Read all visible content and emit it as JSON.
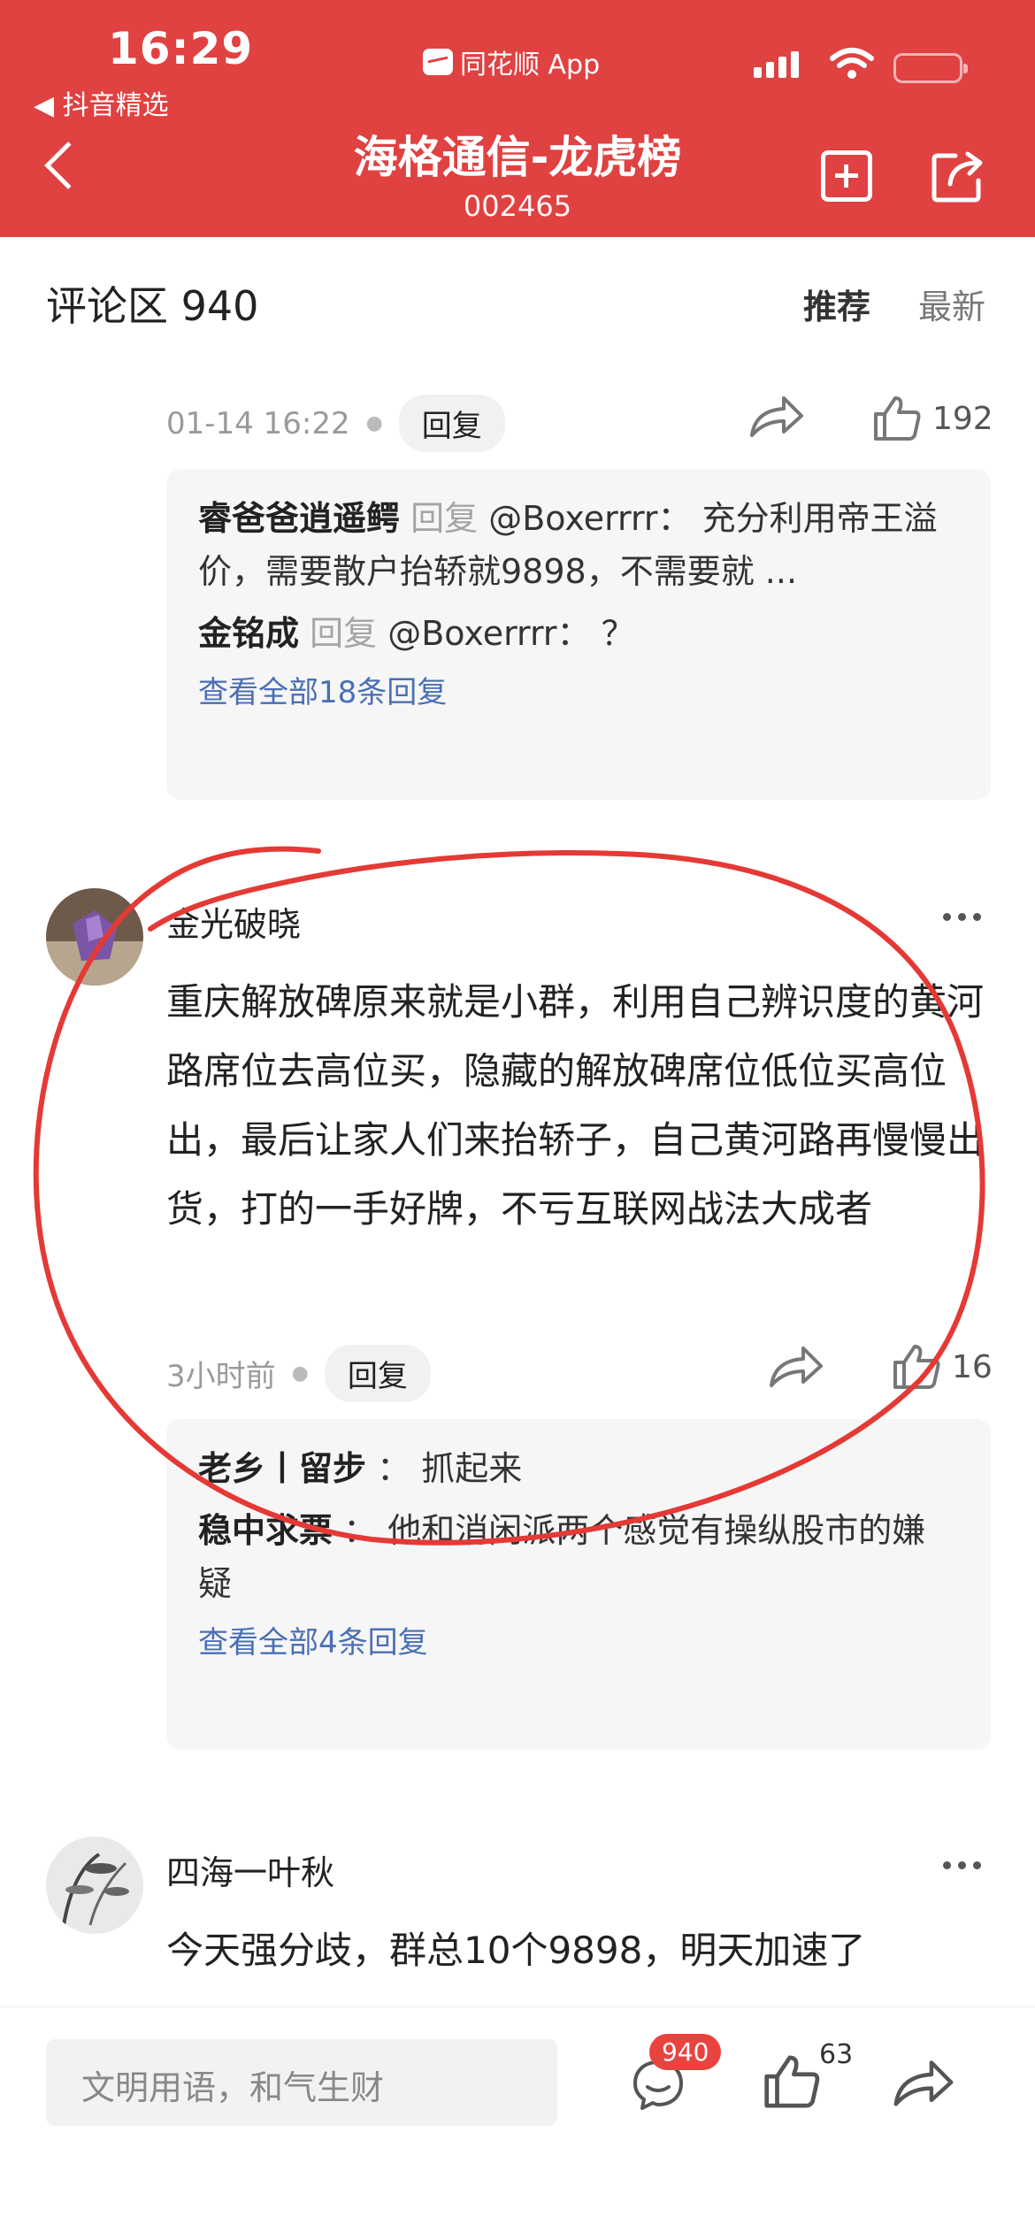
{
  "status": {
    "time": "16:29",
    "back_app": "◀ 抖音精选",
    "app_name": "同花顺 App"
  },
  "nav": {
    "title": "海格通信-龙虎榜",
    "code": "002465"
  },
  "comments_header": {
    "title": "评论区 940",
    "sort_recommend": "推荐",
    "sort_latest": "最新"
  },
  "comment1": {
    "time": "01-14 16:22",
    "reply_label": "回复",
    "likes": "192",
    "replies": [
      {
        "name": "睿爸爸逍遥鳄",
        "reply_word": "回复",
        "text": "@Boxerrrr： 充分利用帝王溢价，需要散户抬轿就9898，不需要就 ..."
      },
      {
        "name": "金铭成",
        "reply_word": "回复",
        "text": "@Boxerrrr： ？"
      }
    ],
    "view_all": "查看全部18条回复"
  },
  "comment2": {
    "user": "金光破晓",
    "text": "重庆解放碑原来就是小群，利用自己辨识度的黄河路席位去高位买，隐藏的解放碑席位低位买高位出，最后让家人们来抬轿子，自己黄河路再慢慢出货，打的一手好牌，不亏互联网战法大成者",
    "time": "3小时前",
    "reply_label": "回复",
    "likes": "16",
    "replies": [
      {
        "name": "老乡丨留步",
        "text": "： 抓起来"
      },
      {
        "name": "稳中求票",
        "text": "： 他和消闲派两个感觉有操纵股市的嫌疑"
      }
    ],
    "view_all": "查看全部4条回复"
  },
  "comment3": {
    "user": "四海一叶秋",
    "text": "今天强分歧，群总10个9898，明天加速了"
  },
  "bottom_bar": {
    "input_placeholder": "文明用语，和气生财",
    "comment_count": "940",
    "like_count": "63"
  },
  "colors": {
    "brand_red": "#e04141",
    "link_blue": "#4a6fb5",
    "annotation_red": "#e53935"
  }
}
